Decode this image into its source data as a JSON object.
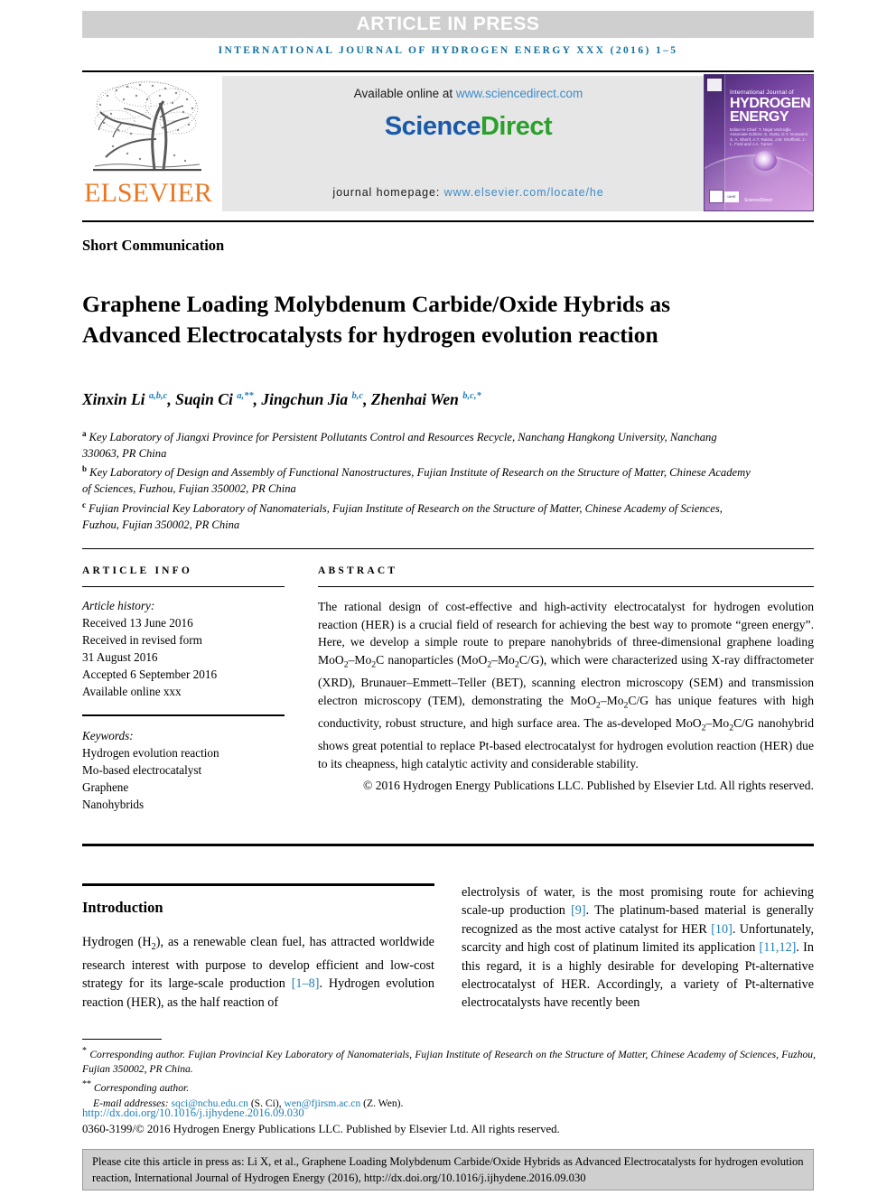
{
  "banner": {
    "label": "ARTICLE IN PRESS",
    "background": "#cfcfcf"
  },
  "masthead": {
    "text": "INTERNATIONAL JOURNAL OF HYDROGEN ENERGY XXX (2016) 1–5",
    "color": "#1070a0"
  },
  "header": {
    "publisher_logo_text": "ELSEVIER",
    "publisher_logo_color": "#e87722",
    "available_prefix": "Available online at ",
    "available_link": "www.sciencedirect.com",
    "sciencedirect_part1": "Science",
    "sciencedirect_part2": "Direct",
    "sciencedirect_blue": "#1a5aa8",
    "sciencedirect_green": "#2ca02c",
    "homepage_prefix": "journal homepage: ",
    "homepage_link": "www.elsevier.com/locate/he",
    "link_color": "#3c8bc8"
  },
  "cover": {
    "line_small": "International Journal of",
    "line_big1": "HYDROGEN",
    "line_big2": "ENERGY",
    "editors": "Editor-in-Chief: T. Nejat Veziroğlu\nAssociate Editors: S. Dutta, D.Y. Goswami, S. A. Sherif,\nA.T. Raissi, J.W. Sheffield,\nJ.-L. Ford and J.A. Turner",
    "footer_mark": "IAHE",
    "footer_sd": "ScienceDirect"
  },
  "article": {
    "type": "Short Communication",
    "title": "Graphene Loading Molybdenum Carbide/Oxide Hybrids as Advanced Electrocatalysts for hydrogen evolution reaction",
    "authors": [
      {
        "name": "Xinxin Li",
        "sup": "a,b,c",
        "sep": ", "
      },
      {
        "name": "Suqin Ci",
        "sup": "a,**",
        "sep": ", "
      },
      {
        "name": "Jingchun Jia",
        "sup": "b,c",
        "sep": ", "
      },
      {
        "name": "Zhenhai Wen",
        "sup": "b,c,*",
        "sep": ""
      }
    ],
    "affiliations": [
      {
        "mark": "a",
        "text": "Key Laboratory of Jiangxi Province for Persistent Pollutants Control and Resources Recycle, Nanchang Hangkong University, Nanchang 330063, PR China"
      },
      {
        "mark": "b",
        "text": "Key Laboratory of Design and Assembly of Functional Nanostructures, Fujian Institute of Research on the Structure of Matter, Chinese Academy of Sciences, Fuzhou, Fujian 350002, PR China"
      },
      {
        "mark": "c",
        "text": "Fujian Provincial Key Laboratory of Nanomaterials, Fujian Institute of Research on the Structure of Matter, Chinese Academy of Sciences, Fuzhou, Fujian 350002, PR China"
      }
    ]
  },
  "article_info": {
    "heading": "ARTICLE INFO",
    "history_label": "Article history:",
    "history": [
      "Received 13 June 2016",
      "Received in revised form",
      "31 August 2016",
      "Accepted 6 September 2016",
      "Available online xxx"
    ],
    "keywords_label": "Keywords:",
    "keywords": [
      "Hydrogen evolution reaction",
      "Mo-based electrocatalyst",
      "Graphene",
      "Nanohybrids"
    ]
  },
  "abstract": {
    "heading": "ABSTRACT",
    "body_html": "The rational design of cost-effective and high-activity electrocatalyst for hydrogen evolution reaction (HER) is a crucial field of research for achieving the best way to promote “green energy”. Here, we develop a simple route to prepare nanohybrids of three-dimensional graphene loading MoO<sub>2</sub>–Mo<sub>2</sub>C nanoparticles (MoO<sub>2</sub>–Mo<sub>2</sub>C/G), which were characterized using X-ray diffractometer (XRD), Brunauer–Emmett–Teller (BET), scanning electron microscopy (SEM) and transmission electron microscopy (TEM), demonstrating the MoO<sub>2</sub>–Mo<sub>2</sub>C/G has unique features with high conductivity, robust structure, and high surface area. The as-developed MoO<sub>2</sub>–Mo<sub>2</sub>C/G nanohybrid shows great potential to replace Pt-based electrocatalyst for hydrogen evolution reaction (HER) due to its cheapness, high catalytic activity and considerable stability.",
    "copyright": "© 2016 Hydrogen Energy Publications LLC. Published by Elsevier Ltd. All rights reserved."
  },
  "introduction": {
    "heading": "Introduction",
    "left_html": "Hydrogen (H<sub>2</sub>), as a renewable clean fuel, has attracted worldwide research interest with purpose to develop efficient and low-cost strategy for its large-scale production <span class=\"ref\">[1–8]</span>. Hydrogen evolution reaction (HER), as the half reaction of",
    "right_html": "electrolysis of water, is the most promising route for achieving scale-up production <span class=\"ref\">[9]</span>. The platinum-based material is generally recognized as the most active catalyst for HER <span class=\"ref\">[10]</span>. Unfortunately, scarcity and high cost of platinum limited its application <span class=\"ref\">[11,12]</span>. In this regard, it is a highly desirable for developing Pt-alternative electrocatalyst of HER. Accordingly, a variety of Pt-alternative electrocatalysts have recently been"
  },
  "footnotes": {
    "corr1_html": "<span class=\"fn-star\">*</span> <span class=\"fn-ital\">Corresponding author. Fujian Provincial Key Laboratory of Nanomaterials, Fujian Institute of Research on the Structure of Matter, Chinese Academy of Sciences, Fuzhou, Fujian 350002, PR China.</span>",
    "corr2_html": "<span class=\"fn-star\">**</span> <span class=\"fn-ital\">Corresponding author.</span>",
    "emails_label": "E-mail addresses:",
    "email1": "sqci@nchu.edu.cn",
    "email1_owner": "(S. Ci)",
    "email2": "wen@fjirsm.ac.cn",
    "email2_owner": "(Z. Wen).",
    "doi": "http://dx.doi.org/10.1016/j.ijhydene.2016.09.030",
    "issn": "0360-3199/© 2016 Hydrogen Energy Publications LLC. Published by Elsevier Ltd. All rights reserved.",
    "link_color": "#1b7eb8"
  },
  "citation_box": {
    "text": "Please cite this article in press as: Li X, et al., Graphene Loading Molybdenum Carbide/Oxide Hybrids as Advanced Electrocatalysts for hydrogen evolution reaction, International Journal of Hydrogen Energy (2016), http://dx.doi.org/10.1016/j.ijhydene.2016.09.030",
    "background": "#cfcfcf"
  }
}
